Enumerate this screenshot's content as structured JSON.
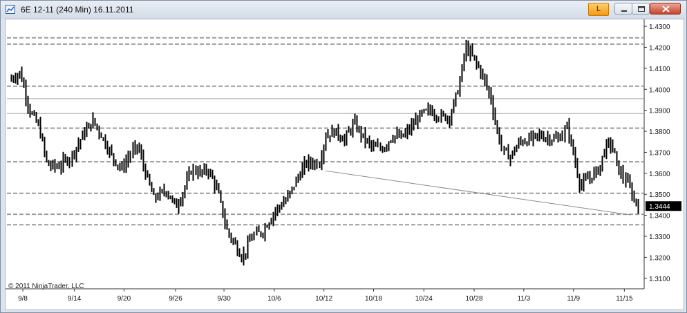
{
  "window": {
    "title": "6E 12-11 (240 Min)  16.11.2011",
    "badge": "L",
    "colors": {
      "titlebar": "#dde4ec",
      "badge": "#f5a623",
      "close": "#c8432a"
    }
  },
  "copyright": "© 2011 NinjaTrader, LLC",
  "chart_data": {
    "type": "ohlc-bar",
    "x_ticks": [
      "9/8",
      "9/14",
      "9/20",
      "9/26",
      "9/30",
      "10/6",
      "10/12",
      "10/18",
      "10/24",
      "10/28",
      "11/3",
      "11/9",
      "11/15"
    ],
    "y_ticks": [
      "1.4300",
      "1.4200",
      "1.4100",
      "1.4000",
      "1.3900",
      "1.3800",
      "1.3700",
      "1.3600",
      "1.3500",
      "1.3400",
      "1.3300",
      "1.3200",
      "1.3100"
    ],
    "ylim": [
      1.305,
      1.432
    ],
    "last_price": "1.3444",
    "grid": false,
    "dashed_levels": [
      1.4245,
      1.4215,
      1.4015,
      1.3815,
      1.3655,
      1.3505,
      1.3405,
      1.3355
    ],
    "solid_levels": [
      1.3955,
      1.3885
    ],
    "trendline": [
      [
        0.5,
        1.3612
      ],
      [
        0.98,
        1.3402
      ]
    ],
    "x_range": [
      0.0,
      1.0
    ],
    "tick_x_pos": [
      0.025,
      0.106,
      0.184,
      0.265,
      0.341,
      0.42,
      0.498,
      0.576,
      0.655,
      0.734,
      0.812,
      0.89,
      0.97
    ],
    "anchors": [
      [
        0.0,
        1.404
      ],
      [
        0.02,
        1.408
      ],
      [
        0.035,
        1.39
      ],
      [
        0.05,
        1.382
      ],
      [
        0.063,
        1.364
      ],
      [
        0.08,
        1.363
      ],
      [
        0.1,
        1.368
      ],
      [
        0.12,
        1.379
      ],
      [
        0.135,
        1.385
      ],
      [
        0.15,
        1.377
      ],
      [
        0.165,
        1.368
      ],
      [
        0.18,
        1.362
      ],
      [
        0.195,
        1.37
      ],
      [
        0.205,
        1.373
      ],
      [
        0.215,
        1.362
      ],
      [
        0.23,
        1.348
      ],
      [
        0.25,
        1.352
      ],
      [
        0.265,
        1.344
      ],
      [
        0.275,
        1.35
      ],
      [
        0.29,
        1.362
      ],
      [
        0.305,
        1.36
      ],
      [
        0.315,
        1.362
      ],
      [
        0.33,
        1.352
      ],
      [
        0.345,
        1.333
      ],
      [
        0.36,
        1.325
      ],
      [
        0.37,
        1.32
      ],
      [
        0.385,
        1.33
      ],
      [
        0.4,
        1.332
      ],
      [
        0.42,
        1.342
      ],
      [
        0.44,
        1.348
      ],
      [
        0.455,
        1.357
      ],
      [
        0.47,
        1.365
      ],
      [
        0.49,
        1.365
      ],
      [
        0.5,
        1.378
      ],
      [
        0.515,
        1.38
      ],
      [
        0.53,
        1.376
      ],
      [
        0.545,
        1.384
      ],
      [
        0.56,
        1.377
      ],
      [
        0.575,
        1.372
      ],
      [
        0.59,
        1.372
      ],
      [
        0.605,
        1.378
      ],
      [
        0.62,
        1.377
      ],
      [
        0.635,
        1.382
      ],
      [
        0.65,
        1.388
      ],
      [
        0.665,
        1.39
      ],
      [
        0.68,
        1.387
      ],
      [
        0.695,
        1.387
      ],
      [
        0.71,
        1.402
      ],
      [
        0.72,
        1.42
      ],
      [
        0.73,
        1.416
      ],
      [
        0.745,
        1.408
      ],
      [
        0.76,
        1.396
      ],
      [
        0.77,
        1.38
      ],
      [
        0.78,
        1.37
      ],
      [
        0.79,
        1.368
      ],
      [
        0.805,
        1.375
      ],
      [
        0.82,
        1.376
      ],
      [
        0.835,
        1.378
      ],
      [
        0.85,
        1.377
      ],
      [
        0.865,
        1.376
      ],
      [
        0.88,
        1.382
      ],
      [
        0.89,
        1.368
      ],
      [
        0.9,
        1.354
      ],
      [
        0.915,
        1.358
      ],
      [
        0.93,
        1.362
      ],
      [
        0.94,
        1.373
      ],
      [
        0.95,
        1.374
      ],
      [
        0.96,
        1.362
      ],
      [
        0.975,
        1.355
      ],
      [
        0.985,
        1.347
      ],
      [
        0.995,
        1.3444
      ]
    ]
  }
}
